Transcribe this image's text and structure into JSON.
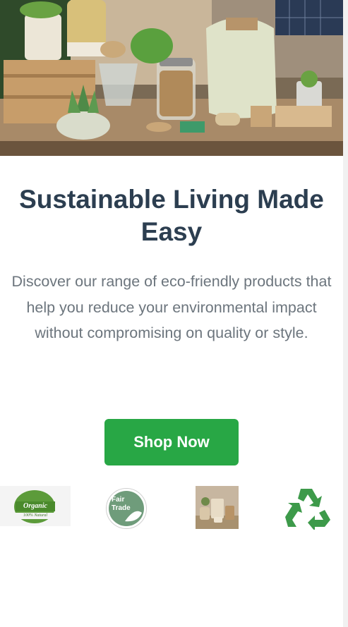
{
  "hero": {
    "headline_line1": "Sustainable Living Made",
    "headline_line2": "Easy",
    "description": "Discover our range of eco-friendly products that help you reduce your environmental impact without compromising on quality or style.",
    "cta_label": "Shop Now"
  },
  "badges": {
    "organic": {
      "title": "Organic",
      "subtitle": "100% Natural"
    },
    "fair_trade": {
      "line1": "Fair",
      "line2": "Trade"
    }
  },
  "colors": {
    "heading": "#2c3e50",
    "body_text": "#6c757d",
    "cta": "#28a745",
    "recycle": "#3d9a4a"
  }
}
